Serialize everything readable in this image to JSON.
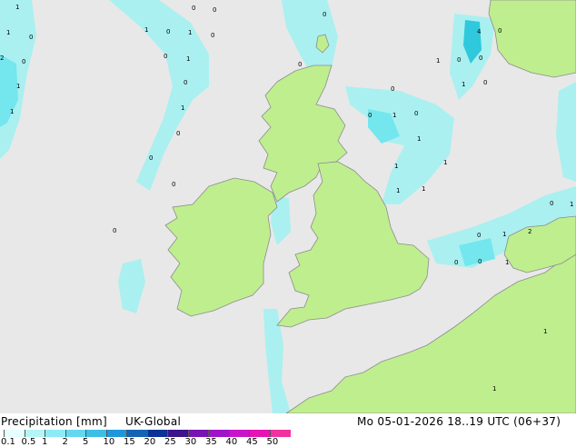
{
  "map": {
    "colors": {
      "sea": "#e8e8e8",
      "land": "#bfee8f",
      "coast": "#8c8c8c",
      "precip_light": "#aaf0f0",
      "precip_mid": "#74e6ee",
      "precip_heavy": "#2fc8dc"
    },
    "labels": [
      "1",
      "0",
      "0",
      "1",
      "0",
      "1",
      "0",
      "2",
      "0",
      "1",
      "0",
      "1",
      "0",
      "1",
      "0",
      "1",
      "1",
      "0",
      "0",
      "4",
      "1",
      "0",
      "0",
      "1",
      "0",
      "0",
      "1",
      "0",
      "0",
      "0",
      "1",
      "1",
      "1",
      "1",
      "1",
      "0",
      "1",
      "0",
      "0",
      "1",
      "2",
      "0",
      "0",
      "1",
      "0",
      "0",
      "0",
      "1",
      "1"
    ]
  },
  "footer": {
    "title": "Precipitation [mm]",
    "model": "UK-Global",
    "datetime": "Mo 05-01-2026 18..19 UTC (06+37)",
    "ticks": [
      "0.1",
      "0.5",
      "1",
      "2",
      "5",
      "10",
      "15",
      "20",
      "25",
      "30",
      "35",
      "40",
      "45",
      "50"
    ],
    "colorbar": [
      "#e6ffff",
      "#b4f5f5",
      "#8cebf5",
      "#64d7f0",
      "#3cbee6",
      "#1e96dc",
      "#1464b4",
      "#0a3296",
      "#3c148c",
      "#7814b4",
      "#a014c8",
      "#c814c8",
      "#e614b4",
      "#f032a0"
    ]
  }
}
